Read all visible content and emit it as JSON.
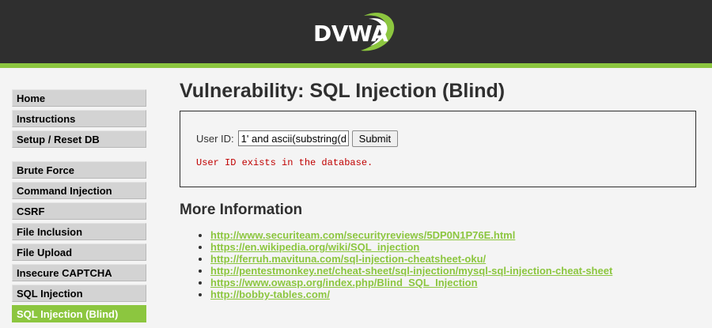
{
  "header": {
    "logo_text": "DVWA",
    "colors": {
      "background": "#2f2f2f",
      "accent": "#8cc63f"
    }
  },
  "sidebar": {
    "groups": [
      {
        "items": [
          {
            "label": "Home"
          },
          {
            "label": "Instructions"
          },
          {
            "label": "Setup / Reset DB"
          }
        ]
      },
      {
        "items": [
          {
            "label": "Brute Force"
          },
          {
            "label": "Command Injection"
          },
          {
            "label": "CSRF"
          },
          {
            "label": "File Inclusion"
          },
          {
            "label": "File Upload"
          },
          {
            "label": "Insecure CAPTCHA"
          },
          {
            "label": "SQL Injection"
          },
          {
            "label": "SQL Injection (Blind)",
            "selected": true
          }
        ]
      }
    ]
  },
  "main": {
    "title": "Vulnerability: SQL Injection (Blind)",
    "form": {
      "label": "User ID:",
      "input_value": "1' and ascii(substring(d",
      "submit_label": "Submit"
    },
    "result_message": "User ID exists in the database.",
    "more_info": {
      "heading": "More Information",
      "links": [
        "http://www.securiteam.com/securityreviews/5DP0N1P76E.html",
        "https://en.wikipedia.org/wiki/SQL_injection",
        "http://ferruh.mavituna.com/sql-injection-cheatsheet-oku/",
        "http://pentestmonkey.net/cheat-sheet/sql-injection/mysql-sql-injection-cheat-sheet",
        "https://www.owasp.org/index.php/Blind_SQL_Injection",
        "http://bobby-tables.com/"
      ]
    }
  }
}
